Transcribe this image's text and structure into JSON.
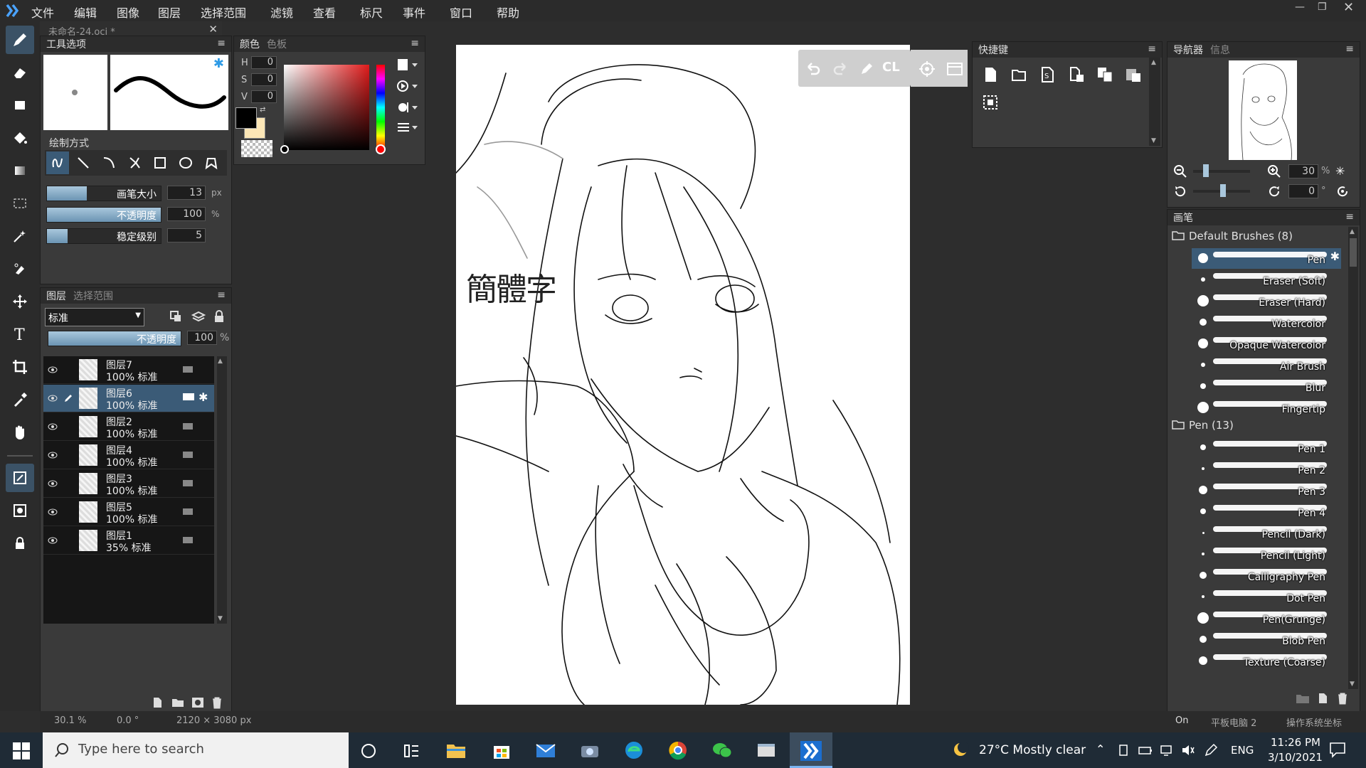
{
  "menu": [
    "文件",
    "编辑",
    "图像",
    "图层",
    "选择范围",
    "滤镜",
    "查看",
    "标尺",
    "事件",
    "窗口",
    "帮助"
  ],
  "document_tab": "未命名-24.oci *",
  "tool_options": {
    "title": "工具选项",
    "draw_mode_label": "绘制方式",
    "brush_size_label": "画笔大小",
    "brush_size_value": "13",
    "brush_size_unit": "px",
    "brush_size_fraction": 0.35,
    "opacity_label": "不透明度",
    "opacity_value": "100",
    "opacity_unit": "%",
    "opacity_fraction": 1.0,
    "stabilizer_label": "稳定级别",
    "stabilizer_value": "5",
    "stabilizer_fraction": 0.18
  },
  "color_panel": {
    "tab_color": "颜色",
    "tab_palette": "色板",
    "h_label": "H",
    "h_value": "0",
    "s_label": "S",
    "s_value": "0",
    "v_label": "V",
    "v_value": "0",
    "primary_color": "#000000",
    "secondary_color": "#fce6b6"
  },
  "shortcuts_panel": {
    "title": "快捷键"
  },
  "canvas_toolbar": {
    "cl_label": "CL"
  },
  "layers_panel": {
    "tab_layers": "图层",
    "tab_selection": "选择范围",
    "blend_mode": "标准",
    "opacity_label": "不透明度",
    "opacity_value": "100",
    "opacity_unit": "%",
    "layers": [
      {
        "name": "图层7",
        "mode": "100% 标准",
        "selected": false
      },
      {
        "name": "图层6",
        "mode": "100% 标准",
        "selected": true
      },
      {
        "name": "图层2",
        "mode": "100% 标准",
        "selected": false
      },
      {
        "name": "图层4",
        "mode": "100% 标准",
        "selected": false
      },
      {
        "name": "图层3",
        "mode": "100% 标准",
        "selected": false
      },
      {
        "name": "图层5",
        "mode": "100% 标准",
        "selected": false
      },
      {
        "name": "图层1",
        "mode": "35% 标准",
        "selected": false
      }
    ]
  },
  "navigator": {
    "tab_navigator": "导航器",
    "tab_info": "信息",
    "zoom_value": "30",
    "zoom_unit": "%",
    "rotation_value": "0",
    "rotation_unit": "°"
  },
  "brush_panel": {
    "title": "画笔",
    "groups": [
      {
        "name": "Default Brushes (8)",
        "brushes": [
          "Pen",
          "Eraser (Soft)",
          "Eraser (Hard)",
          "Watercolor",
          "Opaque Watercolor",
          "Air Brush",
          "Blur",
          "Fingertip"
        ]
      },
      {
        "name": "Pen (13)",
        "brushes": [
          "Pen 1",
          "Pen 2",
          "Pen 3",
          "Pen 4",
          "Pencil (Dark)",
          "Pencil (Light)",
          "Calligraphy Pen",
          "Dot Pen",
          "Pen(Grunge)",
          "Blob Pen",
          "Texture (Coarse)"
        ]
      }
    ]
  },
  "status_bar": {
    "zoom": "30.1 %",
    "angle": "0.0 °",
    "size": "2120 × 3080 px",
    "on_label": "On",
    "tablet_label": "平板电脑 2",
    "coord_label": "操作系统坐标"
  },
  "canvas_text": "簡體字",
  "taskbar": {
    "search_placeholder": "Type here to search",
    "weather": "27°C  Mostly clear",
    "lang": "ENG",
    "time": "11:26 PM",
    "date": "3/10/2021"
  },
  "colors": {
    "accent": "#3b5b77",
    "panel": "#3a3a3a",
    "bg": "#2d2d2d"
  }
}
